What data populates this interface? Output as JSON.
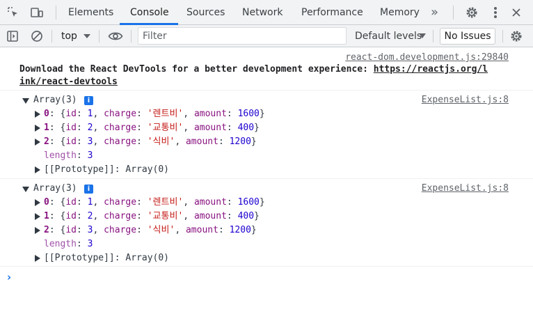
{
  "tabs": {
    "items": [
      "Elements",
      "Console",
      "Sources",
      "Network",
      "Performance",
      "Memory"
    ],
    "active": "Console",
    "overflow_glyph": "»"
  },
  "toolbar": {
    "context": "top",
    "filter_placeholder": "Filter",
    "filter_value": "",
    "levels": "Default levels",
    "issues": "No Issues"
  },
  "console": {
    "devtools_msg": {
      "source": "react-dom.development.js:29840",
      "text": "Download the React DevTools for a better development experience: ",
      "link_part1": "https://reactjs.org/l",
      "link_part2": "ink/react-devtools"
    },
    "logs": [
      {
        "source": "ExpenseList.js:8",
        "label": "Array(3)",
        "info": "i",
        "items": [
          {
            "index": "0",
            "id": "1",
            "charge": "'렌트비'",
            "amount": "1600"
          },
          {
            "index": "1",
            "id": "2",
            "charge": "'교통비'",
            "amount": "400"
          },
          {
            "index": "2",
            "id": "3",
            "charge": "'식비'",
            "amount": "1200"
          }
        ],
        "length_key": "length",
        "length_value": "3",
        "prototype": "[[Prototype]]: Array(0)"
      },
      {
        "source": "ExpenseList.js:8",
        "label": "Array(3)",
        "info": "i",
        "items": [
          {
            "index": "0",
            "id": "1",
            "charge": "'렌트비'",
            "amount": "1600"
          },
          {
            "index": "1",
            "id": "2",
            "charge": "'교통비'",
            "amount": "400"
          },
          {
            "index": "2",
            "id": "3",
            "charge": "'식비'",
            "amount": "1200"
          }
        ],
        "length_key": "length",
        "length_value": "3",
        "prototype": "[[Prototype]]: Array(0)"
      }
    ],
    "prompt_glyph": "›"
  },
  "colors": {
    "accent": "#1a73e8",
    "string": "#c41a16",
    "number": "#1c00cf",
    "key": "#881280"
  }
}
